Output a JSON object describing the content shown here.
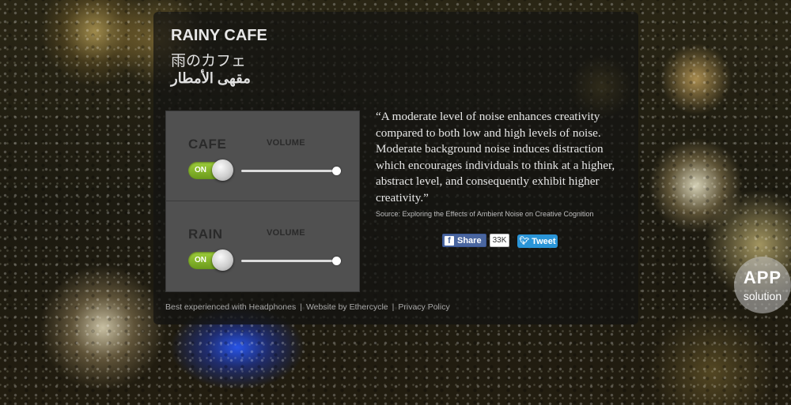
{
  "app": {
    "title_en": "RAINY CAFE",
    "title_ja": "雨のカフェ",
    "title_ar": "مقهى الأمطار"
  },
  "channels": [
    {
      "name": "CAFE",
      "volume_label": "VOLUME",
      "toggle_label": "ON",
      "on": true,
      "volume": 1.0
    },
    {
      "name": "RAIN",
      "volume_label": "VOLUME",
      "toggle_label": "ON",
      "on": true,
      "volume": 1.0
    }
  ],
  "quote": {
    "text": "“A moderate level of noise enhances creativity compared to both low and high levels of noise. Moderate background noise induces distraction which encourages individuals to think at a higher, abstract level, and consequently exhibit higher creativity.”",
    "source": "Source: Exploring the Effects of Ambient Noise on Creative Cognition"
  },
  "social": {
    "facebook_label": "Share",
    "facebook_icon": "f",
    "facebook_count": "33K",
    "twitter_label": "Tweet",
    "twitter_icon": "bird-icon"
  },
  "footer": {
    "headphones": "Best experienced with Headphones",
    "website": "Website by Ethercycle",
    "privacy": "Privacy Policy",
    "separator": "|"
  },
  "watermark": {
    "big": "APP",
    "small": "solution"
  },
  "colors": {
    "toggle_on": "#8cc232",
    "facebook": "#4a66a0",
    "twitter": "#2a95d8"
  }
}
